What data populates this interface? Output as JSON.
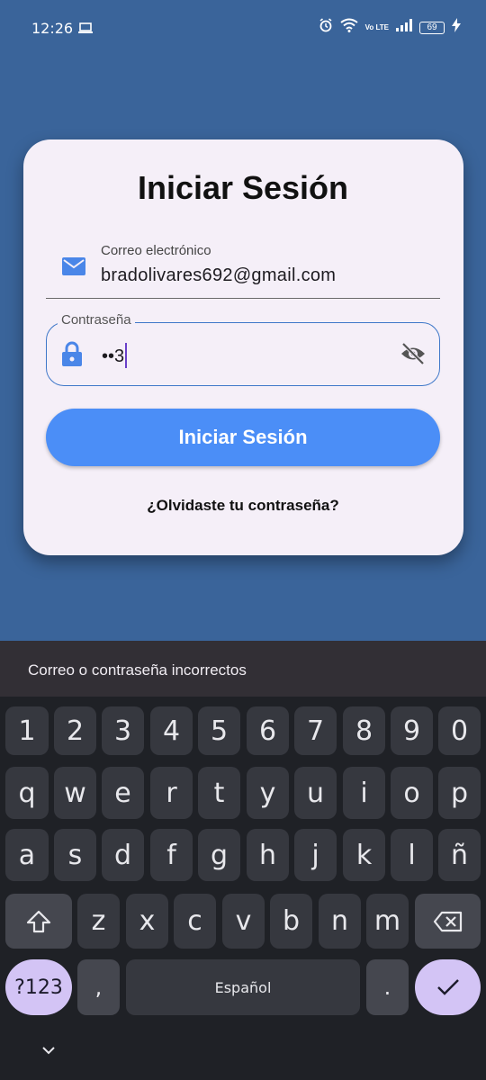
{
  "status_bar": {
    "time": "12:26",
    "battery": "69",
    "network": "Vo LTE"
  },
  "login_card": {
    "title": "Iniciar Sesión",
    "email_label": "Correo electrónico",
    "email_value": "bradolivares692@gmail.com",
    "password_label": "Contraseña",
    "password_value": "••3",
    "login_button": "Iniciar Sesión",
    "forgot_link": "¿Olvidaste tu contraseña?"
  },
  "snackbar": {
    "message": "Correo o contraseña incorrectos"
  },
  "keyboard": {
    "number_row": [
      "1",
      "2",
      "3",
      "4",
      "5",
      "6",
      "7",
      "8",
      "9",
      "0"
    ],
    "row1": [
      "q",
      "w",
      "e",
      "r",
      "t",
      "y",
      "u",
      "i",
      "o",
      "p"
    ],
    "row2": [
      "a",
      "s",
      "d",
      "f",
      "g",
      "h",
      "j",
      "k",
      "l",
      "ñ"
    ],
    "row3": [
      "z",
      "x",
      "c",
      "v",
      "b",
      "n",
      "m"
    ],
    "symbols_key": "?123",
    "comma_key": ",",
    "space_label": "Español",
    "period_key": "."
  }
}
